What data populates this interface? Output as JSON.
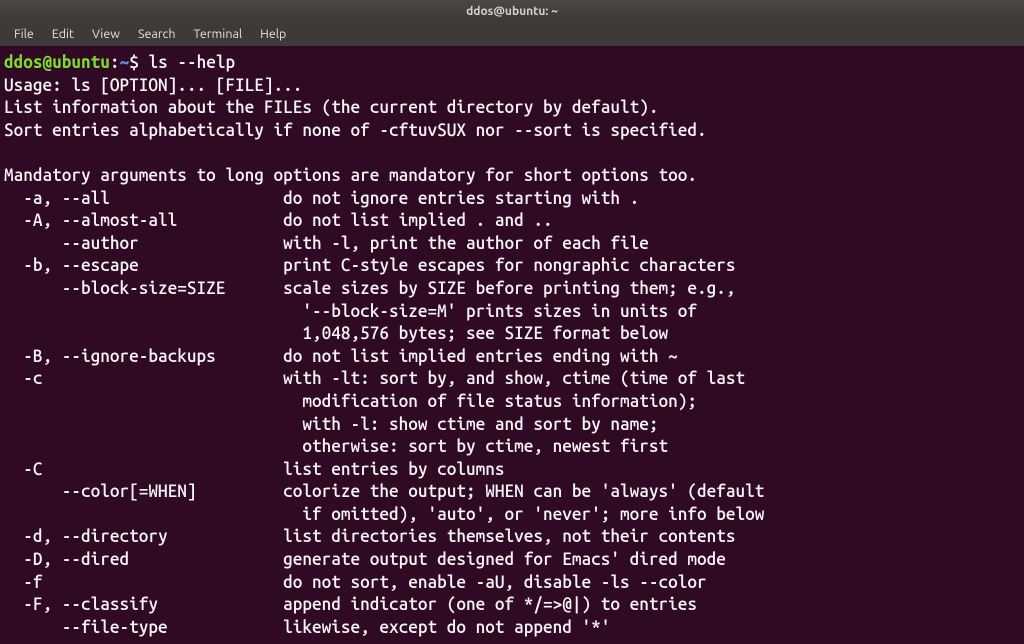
{
  "window": {
    "title": "ddos@ubuntu: ~"
  },
  "menu": {
    "items": [
      "File",
      "Edit",
      "View",
      "Search",
      "Terminal",
      "Help"
    ]
  },
  "prompt": {
    "user": "ddos",
    "at": "@",
    "host": "ubuntu",
    "colon": ":",
    "path": "~",
    "dollar": "$ ",
    "command": "ls --help"
  },
  "output_lines": [
    "Usage: ls [OPTION]... [FILE]...",
    "List information about the FILEs (the current directory by default).",
    "Sort entries alphabetically if none of -cftuvSUX nor --sort is specified.",
    "",
    "Mandatory arguments to long options are mandatory for short options too.",
    "  -a, --all                  do not ignore entries starting with .",
    "  -A, --almost-all           do not list implied . and ..",
    "      --author               with -l, print the author of each file",
    "  -b, --escape               print C-style escapes for nongraphic characters",
    "      --block-size=SIZE      scale sizes by SIZE before printing them; e.g.,",
    "                               '--block-size=M' prints sizes in units of",
    "                               1,048,576 bytes; see SIZE format below",
    "  -B, --ignore-backups       do not list implied entries ending with ~",
    "  -c                         with -lt: sort by, and show, ctime (time of last",
    "                               modification of file status information);",
    "                               with -l: show ctime and sort by name;",
    "                               otherwise: sort by ctime, newest first",
    "  -C                         list entries by columns",
    "      --color[=WHEN]         colorize the output; WHEN can be 'always' (default",
    "                               if omitted), 'auto', or 'never'; more info below",
    "  -d, --directory            list directories themselves, not their contents",
    "  -D, --dired                generate output designed for Emacs' dired mode",
    "  -f                         do not sort, enable -aU, disable -ls --color",
    "  -F, --classify             append indicator (one of */=>@|) to entries",
    "      --file-type            likewise, except do not append '*'"
  ]
}
